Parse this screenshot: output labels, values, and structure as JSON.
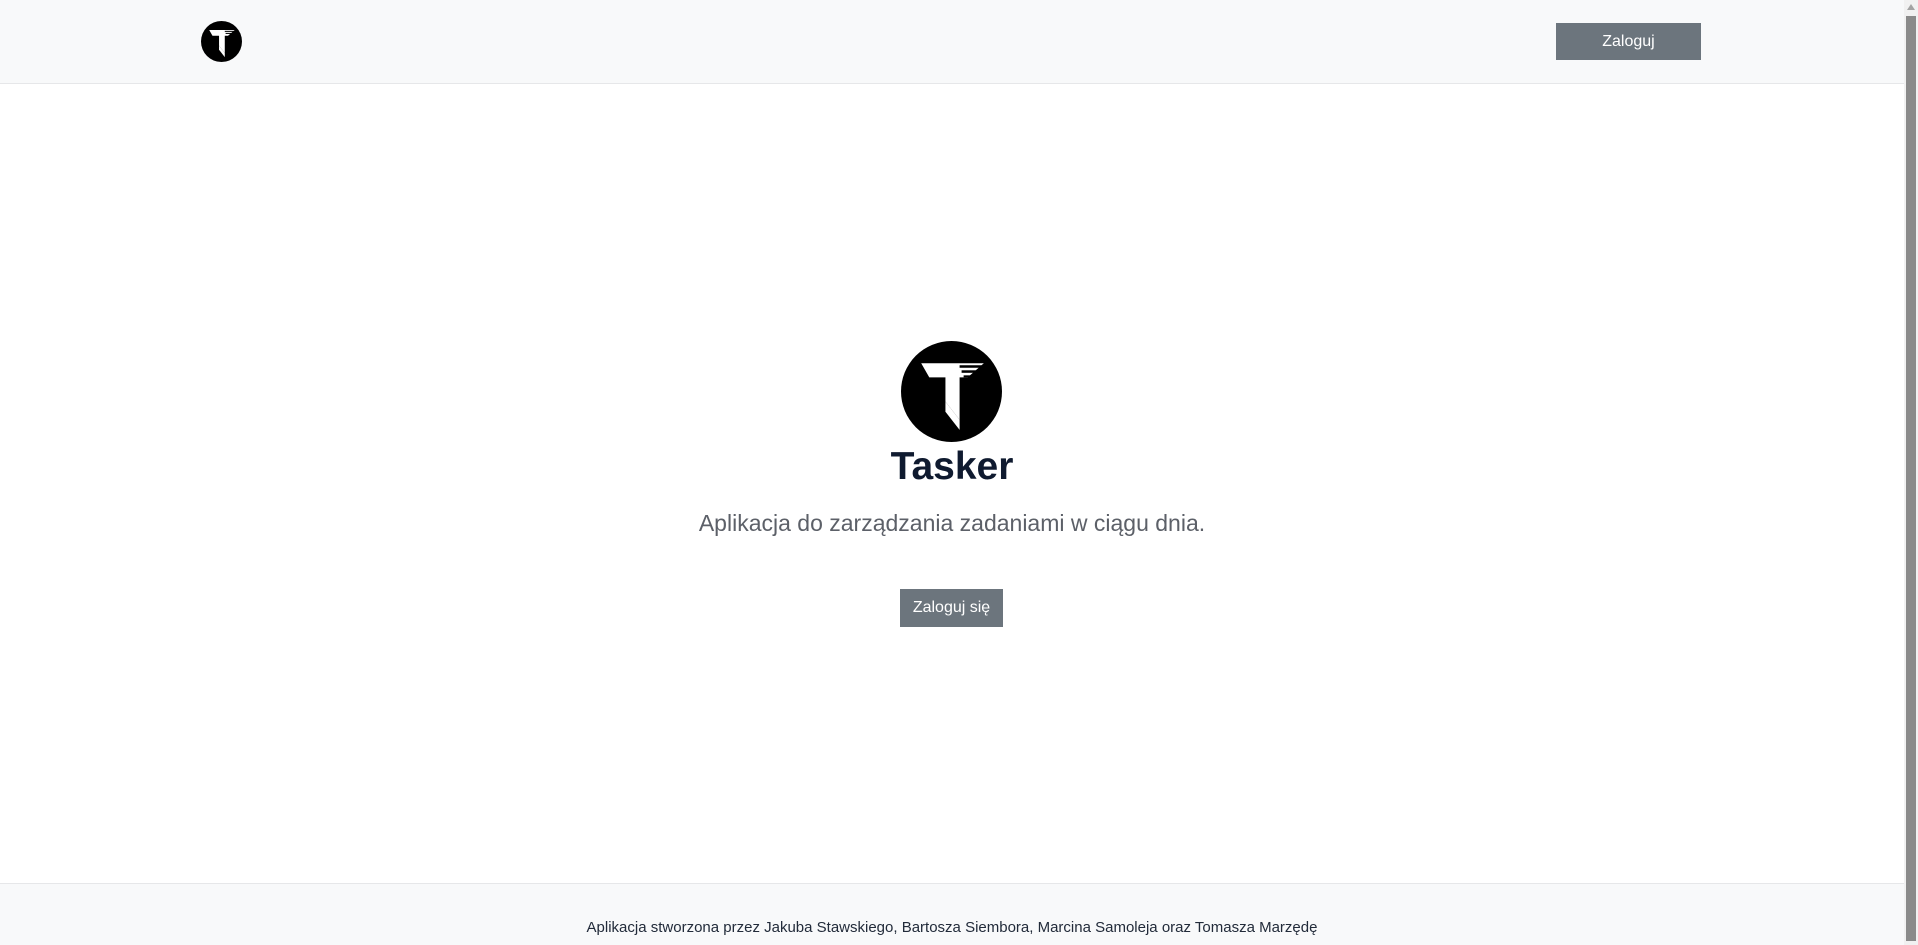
{
  "navbar": {
    "logo_icon": "tasker-logo-icon",
    "login_label": "Zaloguj"
  },
  "hero": {
    "logo_icon": "tasker-logo-icon",
    "title": "Tasker",
    "subtitle": "Aplikacja do zarządzania zadaniami w ciągu dnia.",
    "login_label": "Zaloguj się"
  },
  "footer": {
    "text": "Aplikacja stworzona przez Jakuba Stawskiego, Bartosza Siembora, Marcina Samoleja oraz Tomasza Marzędę"
  },
  "colors": {
    "button_bg": "#6c757d",
    "navbar_bg": "#f8f9fa",
    "title_color": "#0f1a2f"
  }
}
